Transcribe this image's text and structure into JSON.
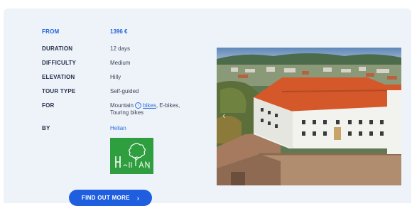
{
  "tour_info": {
    "rows": [
      {
        "label": "FROM",
        "value": "1396 €"
      },
      {
        "label": "DURATION",
        "value": "12 days"
      },
      {
        "label": "DIFFICULTY",
        "value": "Medium"
      },
      {
        "label": "ELEVATION",
        "value": "Hilly"
      },
      {
        "label": "TOUR TYPE",
        "value": "Self-guided"
      },
      {
        "label": "FOR",
        "value_part1": "Mountain ",
        "value_link": "bikes",
        "value_part2": ", E-bikes,",
        "value_line2": "Touring bikes"
      },
      {
        "label": "BY",
        "value": "Helian"
      }
    ]
  },
  "logo": {
    "text": "HELIAN"
  },
  "photo": {
    "prev_arrow": "‹"
  },
  "cta": {
    "label": "FIND OUT MORE",
    "chevron": "›"
  },
  "colors": {
    "accent": "#1f63d8",
    "card_bg": "#eef3fa",
    "logo_green": "#2e9e3f"
  }
}
